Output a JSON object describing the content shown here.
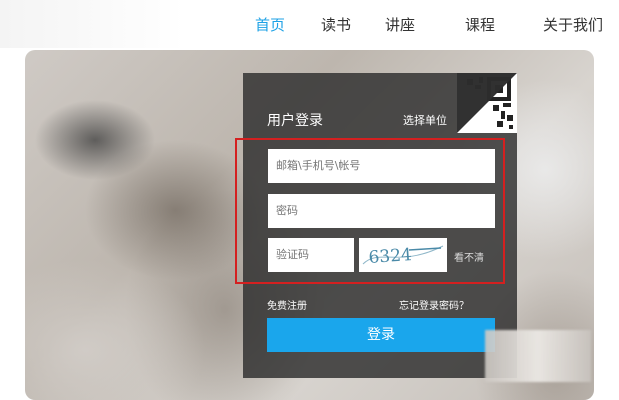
{
  "nav": {
    "items": [
      {
        "label": "首页",
        "active": true
      },
      {
        "label": "读书",
        "active": false
      },
      {
        "label": "讲座",
        "active": false
      },
      {
        "label": "课程",
        "active": false
      },
      {
        "label": "关于我们",
        "active": false
      }
    ]
  },
  "login": {
    "title": "用户登录",
    "select_unit": "选择单位",
    "account_placeholder": "邮箱\\手机号\\帐号",
    "password_placeholder": "密码",
    "captcha_placeholder": "验证码",
    "captcha_text": "6324",
    "refresh_label": "看不清",
    "register_label": "免费注册",
    "forgot_label": "忘记登录密码？",
    "submit_label": "登录"
  },
  "colors": {
    "accent": "#1ea2e6",
    "button": "#1aa6ec",
    "panel": "#2d2d2d",
    "highlight": "#d42020"
  }
}
